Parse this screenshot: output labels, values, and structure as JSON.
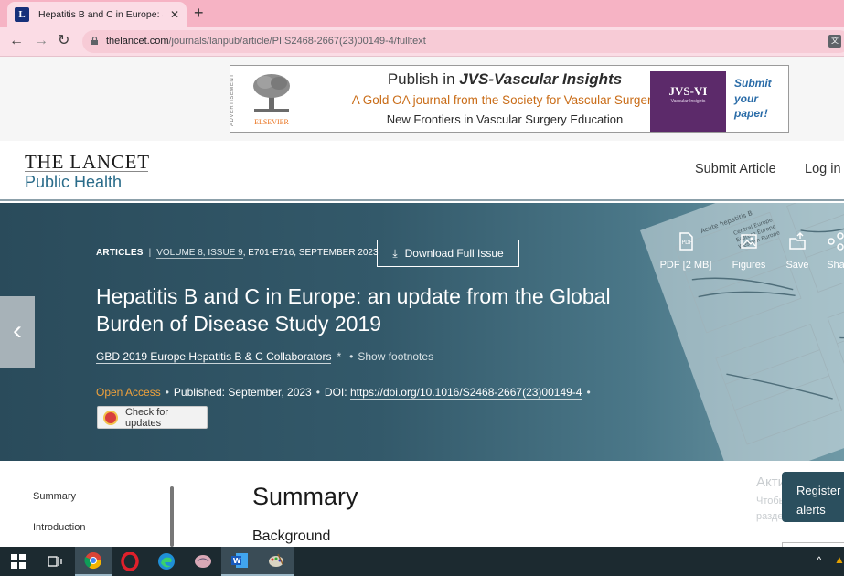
{
  "browser": {
    "tab_title": "Hepatitis B and C in Europe: an u",
    "tab_favicon": "L",
    "url_host": "thelancet.com",
    "url_path": "/journals/lanpub/article/PIIS2468-2667(23)00149-4/fulltext"
  },
  "ad": {
    "label": "ADVERTISEMENT",
    "publisher": "ELSEVIER",
    "line1_prefix": "Publish in ",
    "line1_journal": "JVS-Vascular Insights",
    "line2": "A Gold OA journal from the Society for Vascular Surgery",
    "line3": "New Frontiers in Vascular Surgery Education",
    "cover_title": "JVS-VI",
    "cover_subtitle": "Vascular Insights",
    "cta_lines": [
      "Submit",
      "your",
      "paper!"
    ]
  },
  "journal": {
    "logo_line1": "THE LANCET",
    "logo_line2": "Public Health",
    "submit_article": "Submit Article",
    "login": "Log in"
  },
  "article": {
    "section": "ARTICLES",
    "volume": "VOLUME 8, ISSUE 9",
    "pages_date": ", E701-E716, SEPTEMBER 2023",
    "download_label": "Download Full Issue",
    "title": "Hepatitis B and C in Europe: an update from the Global Burden of Disease Study 2019",
    "authors": "GBD 2019 Europe Hepatitis B & C Collaborators",
    "author_mark": "*",
    "show_footnotes": "Show footnotes",
    "open_access": "Open Access",
    "published_label": "Published:",
    "published_date": "September, 2023",
    "doi_label": "DOI:",
    "doi": "https://doi.org/10.1016/S2468-2667(23)00149-4",
    "check_updates": "Check for updates"
  },
  "tools": {
    "pdf": "PDF [2 MB]",
    "figures": "Figures",
    "save": "Save",
    "share": "Sha"
  },
  "figure_labels": [
    "Acute hepatitis B",
    "Central Europe",
    "Eastern Europe",
    "Western Europe"
  ],
  "content": {
    "toc": [
      "Summary",
      "Introduction"
    ],
    "summary_heading": "Summary",
    "background_heading": "Background",
    "register_lines": [
      "Register",
      "alerts"
    ]
  },
  "watermark": {
    "line1": "Активация W",
    "line2": "Чтобы активиро",
    "line3": "раздел \"Параме"
  },
  "colors": {
    "hero_dark": "#2a4b5b",
    "open_access": "#f0a23c",
    "lancet_blue": "#2a6c8a"
  }
}
